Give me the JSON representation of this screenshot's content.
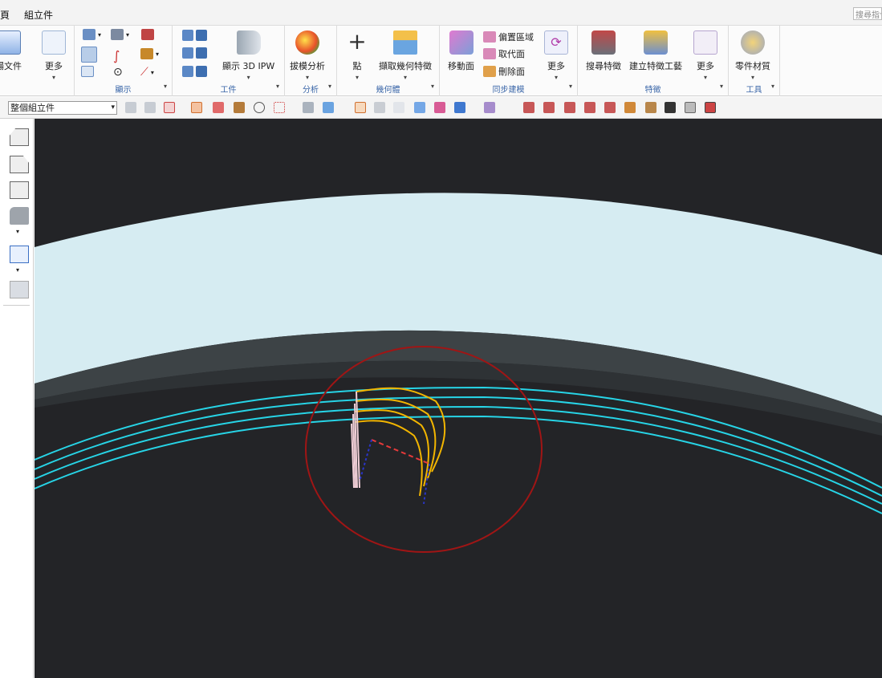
{
  "menubar": {
    "partial_item": "頁",
    "assembly": "組立件",
    "search_placeholder": "搜尋指令"
  },
  "ribbon": {
    "partial_doc": "場文件",
    "more1": "更多",
    "display_label": "顯示",
    "workpiece_label": "工件",
    "show_ipw": "顯示 3D IPW",
    "draft_analysis": "拔模分析",
    "analysis_label": "分析",
    "point": "點",
    "extract_geom": "擷取幾何特徵",
    "geometry_label": "幾何體",
    "move_face": "移動面",
    "offset_region": "偏置區域",
    "replace_face": "取代面",
    "delete_face": "刪除面",
    "more2": "更多",
    "sync_label": "同步建模",
    "find_feature": "搜尋特徵",
    "create_feature_group": "建立特徵工藝",
    "more3": "更多",
    "feature_label": "特徵",
    "part_material": "零件材質",
    "tools_label": "工具"
  },
  "toolbar2": {
    "scope": "整個組立件"
  },
  "colors": {
    "viewport_bg": "#232427",
    "band_light": "#d6ecf2",
    "band_dark": "#3d4346",
    "curve_cyan": "#27d4e6",
    "curve_yellow": "#f2b500",
    "circle": "#a01515"
  }
}
